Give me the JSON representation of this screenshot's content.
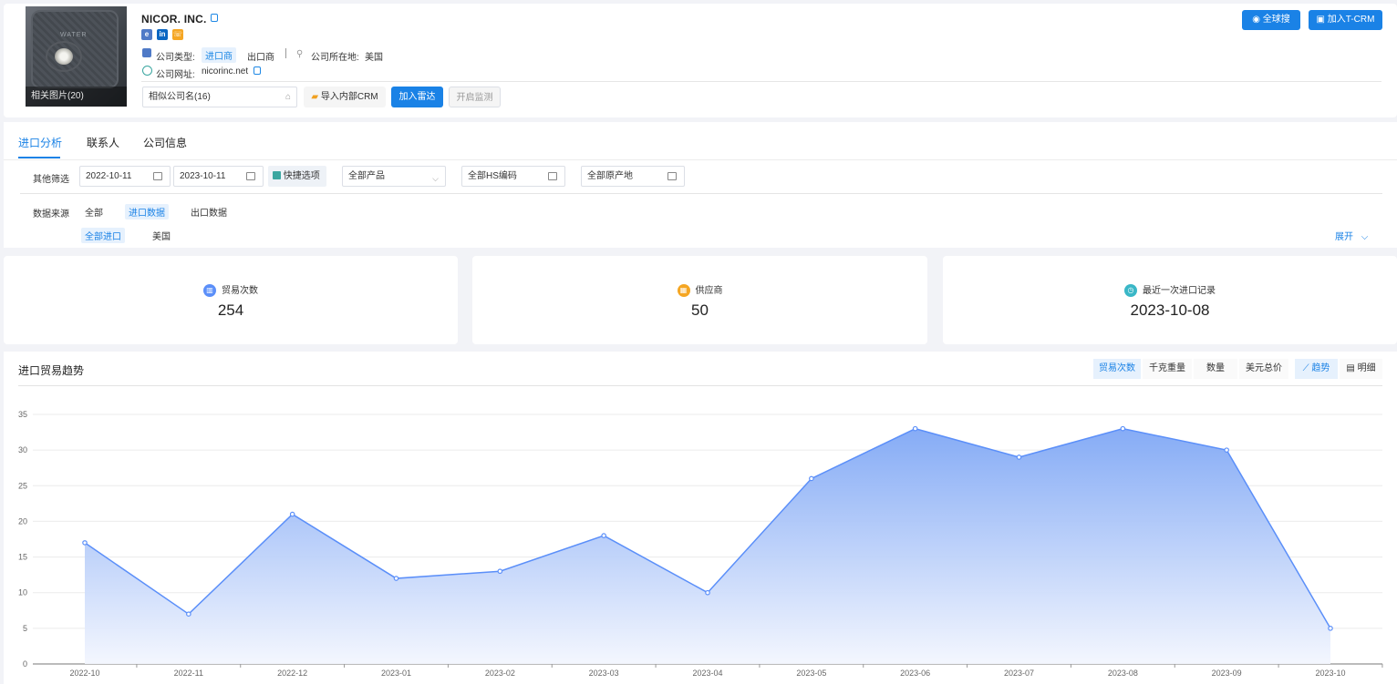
{
  "company": {
    "name": "NICOR. INC.",
    "image_caption": "相关图片(20)",
    "image_text": "WATER",
    "type_label": "公司类型:",
    "type_tags": [
      "进口商",
      "出口商"
    ],
    "location_label": "公司所在地:",
    "location_value": "美国",
    "website_label": "公司网址:",
    "website_value": "nicorinc.net",
    "similar_label": "相似公司名(16)",
    "social": {
      "linkedin": "in",
      "ie": "e"
    }
  },
  "actions": {
    "import_crm": "导入内部CRM",
    "add_radar": "加入雷达",
    "start_monitor": "开启监测",
    "global_search": "全球搜",
    "add_tcrm": "加入T-CRM"
  },
  "tabs": [
    "进口分析",
    "联系人",
    "公司信息"
  ],
  "filters": {
    "label": "其他筛选",
    "date_from": "2022-10-11",
    "date_to": "2023-10-11",
    "quick": "快捷选项",
    "product": "全部产品",
    "hs": "全部HS编码",
    "origin": "全部原产地"
  },
  "source": {
    "label": "数据来源",
    "items": [
      "全部",
      "进口数据",
      "出口数据"
    ],
    "sub_items": [
      "全部进口",
      "美国"
    ],
    "expand": "展开"
  },
  "stats": [
    {
      "label": "贸易次数",
      "value": "254"
    },
    {
      "label": "供应商",
      "value": "50"
    },
    {
      "label": "最近一次进口记录",
      "value": "2023-10-08"
    }
  ],
  "chart_header": {
    "title": "进口贸易趋势",
    "metrics": [
      "贸易次数",
      "千克重量",
      "数量",
      "美元总价"
    ],
    "views": [
      "趋势",
      "明细"
    ]
  },
  "chart_data": {
    "type": "area",
    "x": [
      "2022-10",
      "2022-11",
      "2022-12",
      "2023-01",
      "2023-02",
      "2023-03",
      "2023-04",
      "2023-05",
      "2023-06",
      "2023-07",
      "2023-08",
      "2023-09",
      "2023-10"
    ],
    "series": [
      {
        "values": [
          17,
          7,
          21,
          12,
          13,
          18,
          10,
          26,
          33,
          29,
          33,
          30,
          5
        ]
      }
    ],
    "yticks": [
      0,
      5,
      10,
      15,
      20,
      25,
      30,
      35
    ],
    "ylim": [
      0,
      35
    ],
    "grid": true,
    "colors": {
      "line": "#5b8ff9",
      "fill_top": "#7fa7f5",
      "fill_bottom": "#f3f6fe"
    }
  }
}
